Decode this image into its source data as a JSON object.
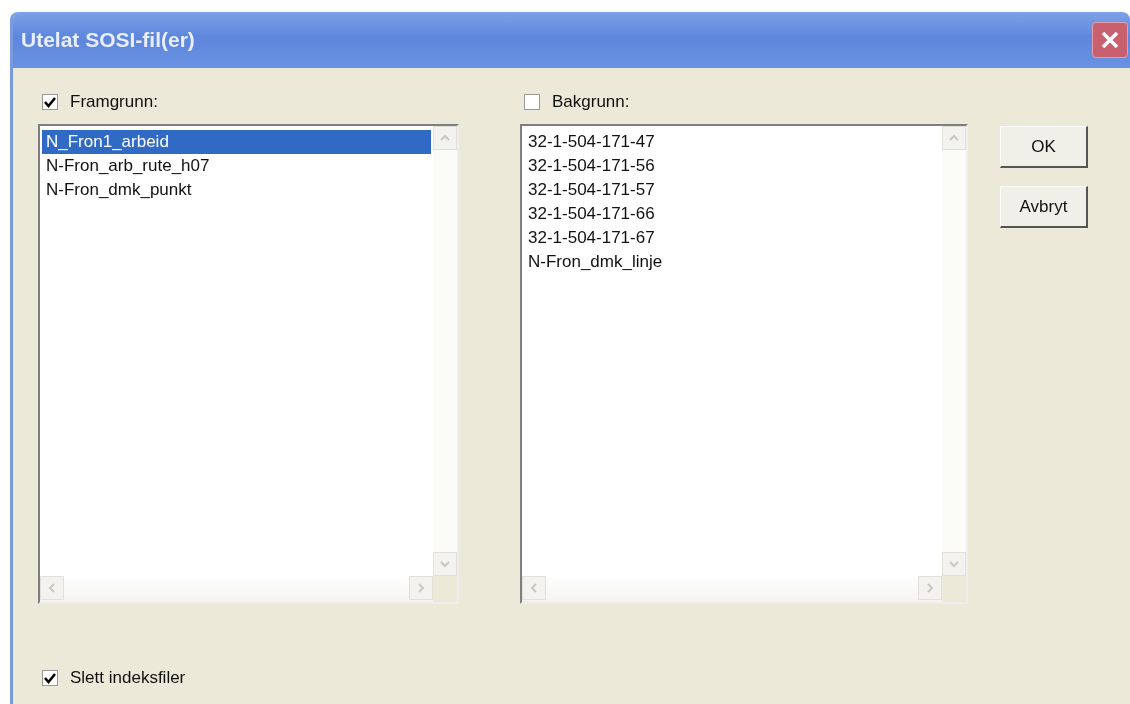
{
  "window": {
    "title": "Utelat SOSI-fil(er)"
  },
  "lists": [
    {
      "label": "Framgrunn:",
      "checked": true,
      "items": [
        {
          "text": "N_Fron1_arbeid",
          "selected": true
        },
        {
          "text": "N-Fron_arb_rute_h07",
          "selected": false
        },
        {
          "text": "N-Fron_dmk_punkt",
          "selected": false
        }
      ]
    },
    {
      "label": "Bakgrunn:",
      "checked": false,
      "items": [
        {
          "text": "32-1-504-171-47",
          "selected": false
        },
        {
          "text": "32-1-504-171-56",
          "selected": false
        },
        {
          "text": "32-1-504-171-57",
          "selected": false
        },
        {
          "text": "32-1-504-171-66",
          "selected": false
        },
        {
          "text": "32-1-504-171-67",
          "selected": false
        },
        {
          "text": "N-Fron_dmk_linje",
          "selected": false
        }
      ]
    }
  ],
  "buttons": [
    "OK",
    "Avbryt"
  ],
  "options": [
    {
      "label": "Slett indeksfiler",
      "checked": true
    }
  ]
}
